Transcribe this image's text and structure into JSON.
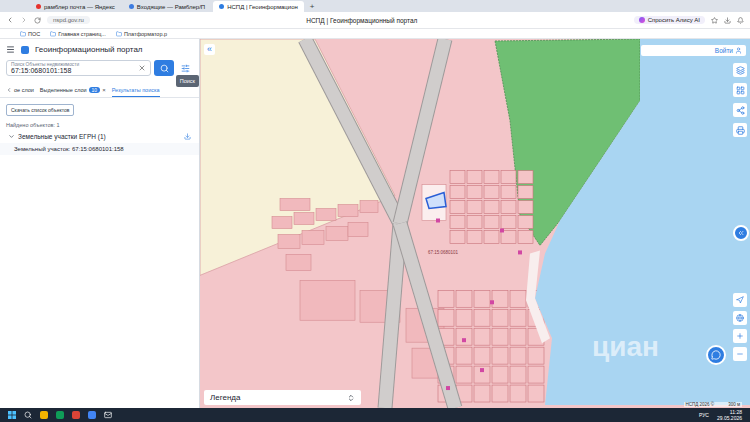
{
  "browser": {
    "tabs": [
      {
        "label": "рамблер почта — Яндекс",
        "selected": false
      },
      {
        "label": "Входящие — Рамблер/П",
        "selected": false
      },
      {
        "label": "НСПД | Геоинформацион",
        "selected": true
      }
    ],
    "new_tab": "+",
    "url": "nspd.gov.ru",
    "page_title": "НСПД | Геоинформационный портал",
    "assistant": "Спросить Алису AI",
    "bookmarks": [
      "ПОС",
      "Главная страниц...",
      "Платформатор.р"
    ]
  },
  "panel": {
    "title": "Геоинформационный портал",
    "search": {
      "label": "Поиск Объекты недвижимости",
      "value": "67:15:0680101:158",
      "tooltip": "Поиск"
    },
    "tabs": [
      {
        "label": "ое слои",
        "kind": "back",
        "selected": false
      },
      {
        "label": "Выделенные слои",
        "kind": "tab",
        "badge": "10",
        "close": "×",
        "selected": false
      },
      {
        "label": "Результаты поиска",
        "kind": "tab",
        "selected": true
      }
    ],
    "download_button": "Скачать список объектов",
    "found": "Найдено объектов: 1",
    "groups": [
      {
        "label": "Земельные участки ЕГРН (1)",
        "expanded": true,
        "items": [
          "Земельный участок: 67:15:0680101:158"
        ]
      }
    ]
  },
  "map": {
    "collapse": "«",
    "login": "Войти",
    "parcel_label": "67:15:0680101",
    "legend": "Легенда",
    "watermark": "циан",
    "attribution": "НСПД 2026 ©",
    "scale": "300 м"
  },
  "taskbar": {
    "language": "РУС",
    "time": "11:28",
    "date": "29.05.2026"
  }
}
